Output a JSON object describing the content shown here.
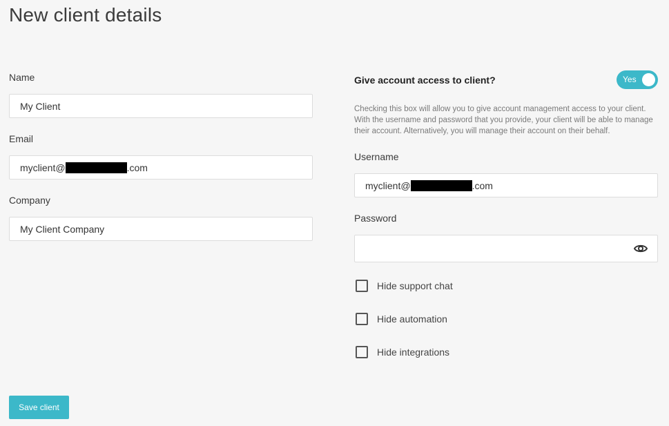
{
  "page": {
    "title": "New client details"
  },
  "left": {
    "name": {
      "label": "Name",
      "value": "My Client"
    },
    "email": {
      "label": "Email",
      "value_prefix": "myclient@",
      "value_suffix": ".com",
      "redacted": true
    },
    "company": {
      "label": "Company",
      "value": "My Client Company"
    }
  },
  "access": {
    "title": "Give account access to client?",
    "toggle": {
      "label": "Yes",
      "state": true,
      "color": "#3cb8c9"
    },
    "description": "Checking this box will allow you to give account management access to your client. With the username and password that you provide, your client will be able to manage their account. Alternatively, you will manage their account on their behalf.",
    "username": {
      "label": "Username",
      "value_prefix": "myclient@",
      "value_suffix": ".com",
      "redacted": true
    },
    "password": {
      "label": "Password",
      "value": "",
      "icon": "eye-icon"
    },
    "options": [
      {
        "label": "Hide support chat",
        "checked": false
      },
      {
        "label": "Hide automation",
        "checked": false
      },
      {
        "label": "Hide integrations",
        "checked": false
      }
    ]
  },
  "actions": {
    "save_label": "Save client",
    "accent_color": "#3cb8c9"
  }
}
